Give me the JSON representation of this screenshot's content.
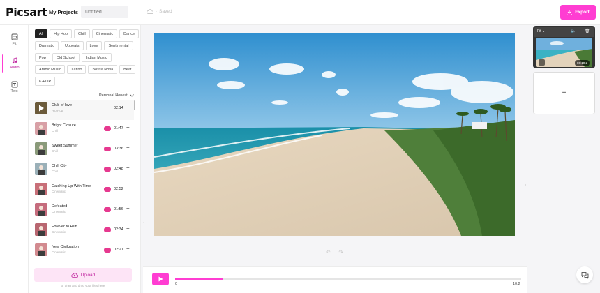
{
  "header": {
    "logo": "Picsart",
    "my_projects": "My Projects",
    "title_placeholder": "Untitled",
    "saved": "Saved",
    "export": "Export",
    "accent": "#ff3dd2"
  },
  "rail": [
    {
      "label": "Fit",
      "icon": "fit-icon"
    },
    {
      "label": "Audio",
      "icon": "music-note-icon"
    },
    {
      "label": "Text",
      "icon": "text-icon"
    }
  ],
  "filters": [
    "All",
    "Hip Hop",
    "Chill",
    "Cinematic",
    "Dance",
    "Dramatic",
    "Upbeats",
    "Love",
    "Sentimental",
    "Pop",
    "Old School",
    "Indian Music",
    "Arabic Music",
    "Latino",
    "Bossa Nova",
    "Beat",
    "K-POP"
  ],
  "selected_filter": "All",
  "sort_label": "Personal Honest",
  "tracks": [
    {
      "name": "Club of love",
      "genre": "Hip Hop",
      "duration": "02:14",
      "active": true
    },
    {
      "name": "Bright Closure",
      "genre": "Chill",
      "duration": "01:47"
    },
    {
      "name": "Sweet Summer",
      "genre": "Chill",
      "duration": "03:36"
    },
    {
      "name": "Chill City",
      "genre": "Chill",
      "duration": "02:48"
    },
    {
      "name": "Catching Up With Time",
      "genre": "Cinematic",
      "duration": "02:52"
    },
    {
      "name": "Defeated",
      "genre": "Cinematic",
      "duration": "01:56"
    },
    {
      "name": "Forever to Run",
      "genre": "Cinematic",
      "duration": "02:34"
    },
    {
      "name": "New Civilization",
      "genre": "Cinematic",
      "duration": "02:21"
    }
  ],
  "upload": {
    "label": "Upload",
    "hint": "or drag and drop your files here"
  },
  "timeline": {
    "start": "0",
    "end": "10.2",
    "progress": 0.14
  },
  "scene": {
    "fit": "Fit",
    "duration": "00:10.2"
  }
}
